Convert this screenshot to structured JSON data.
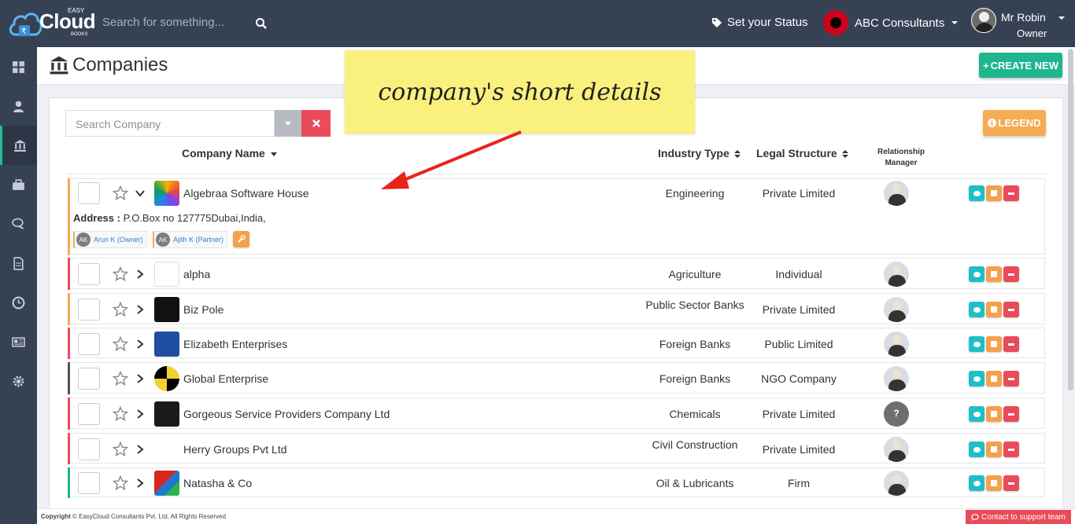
{
  "brand": {
    "name": "Cloud",
    "top": "EASY",
    "bottom": "BOOKS"
  },
  "topbar": {
    "search_placeholder": "Search for something...",
    "status_label": "Set your Status",
    "company": "ABC Consultants",
    "user_name": "Mr Robin",
    "user_role": "Owner"
  },
  "sidebar": {
    "items": [
      "dashboard-icon",
      "user-icon",
      "bank-icon",
      "briefcase-icon",
      "chat-icon",
      "document-icon",
      "clock-icon",
      "newspaper-icon",
      "gear-icon"
    ],
    "active_index": 2
  },
  "page": {
    "title": "Companies",
    "create_label": "CREATE NEW"
  },
  "filters": {
    "search_placeholder": "Search Company",
    "legend_label": "LEGEND"
  },
  "columns": {
    "company_name": "Company Name",
    "industry_type": "Industry Type",
    "legal_structure": "Legal Structure",
    "relationship_manager_1": "Relationship",
    "relationship_manager_2": "Manager"
  },
  "expanded": {
    "address_label": "Address :",
    "address_value": "P.O.Box no 127775Dubai,India,",
    "contacts": [
      {
        "initials": "AK",
        "label": "Arun K (Owner)"
      },
      {
        "initials": "AK",
        "label": "Ajith K (Partner)"
      }
    ]
  },
  "rows": [
    {
      "name": "Algebraa Software House",
      "industry": "Engineering",
      "legal": "Private Limited",
      "accent": "#f6ab55",
      "expanded": true
    },
    {
      "name": "alpha",
      "industry": "Agriculture",
      "legal": "Individual",
      "accent": "#e94b5b"
    },
    {
      "name": "Biz Pole",
      "industry": "Public Sector Banks",
      "legal": "Private Limited",
      "accent": "#f6ab55"
    },
    {
      "name": "Elizabeth Enterprises",
      "industry": "Foreign Banks",
      "legal": "Public Limited",
      "accent": "#e94b5b"
    },
    {
      "name": "Global Enterprise",
      "industry": "Foreign Banks",
      "legal": "NGO Company",
      "accent": "#555555"
    },
    {
      "name": "Gorgeous Service Providers Company Ltd",
      "industry": "Chemicals",
      "legal": "Private Limited",
      "accent": "#e94b5b",
      "manager_unknown": "?"
    },
    {
      "name": "Herry Groups Pvt Ltd",
      "industry": "Civil Construction",
      "legal": "Private Limited",
      "accent": "#e94b5b"
    },
    {
      "name": "Natasha & Co",
      "industry": "Oil & Lubricants",
      "legal": "Firm",
      "accent": "#1fb58f"
    }
  ],
  "annotation": {
    "text": "company's short details"
  },
  "footer": {
    "copyright_bold": "Copyright",
    "copyright_rest": "© EasyCloud Consultants Pvt. Ltd, All Rights Reserved",
    "contact_label": "Contact to support team"
  },
  "colors": {
    "topbar": "#364254",
    "create": "#1fb58f",
    "legend": "#f6ab55",
    "view": "#1fbfc8",
    "edit": "#f6a04d",
    "delete": "#e94b5b"
  }
}
